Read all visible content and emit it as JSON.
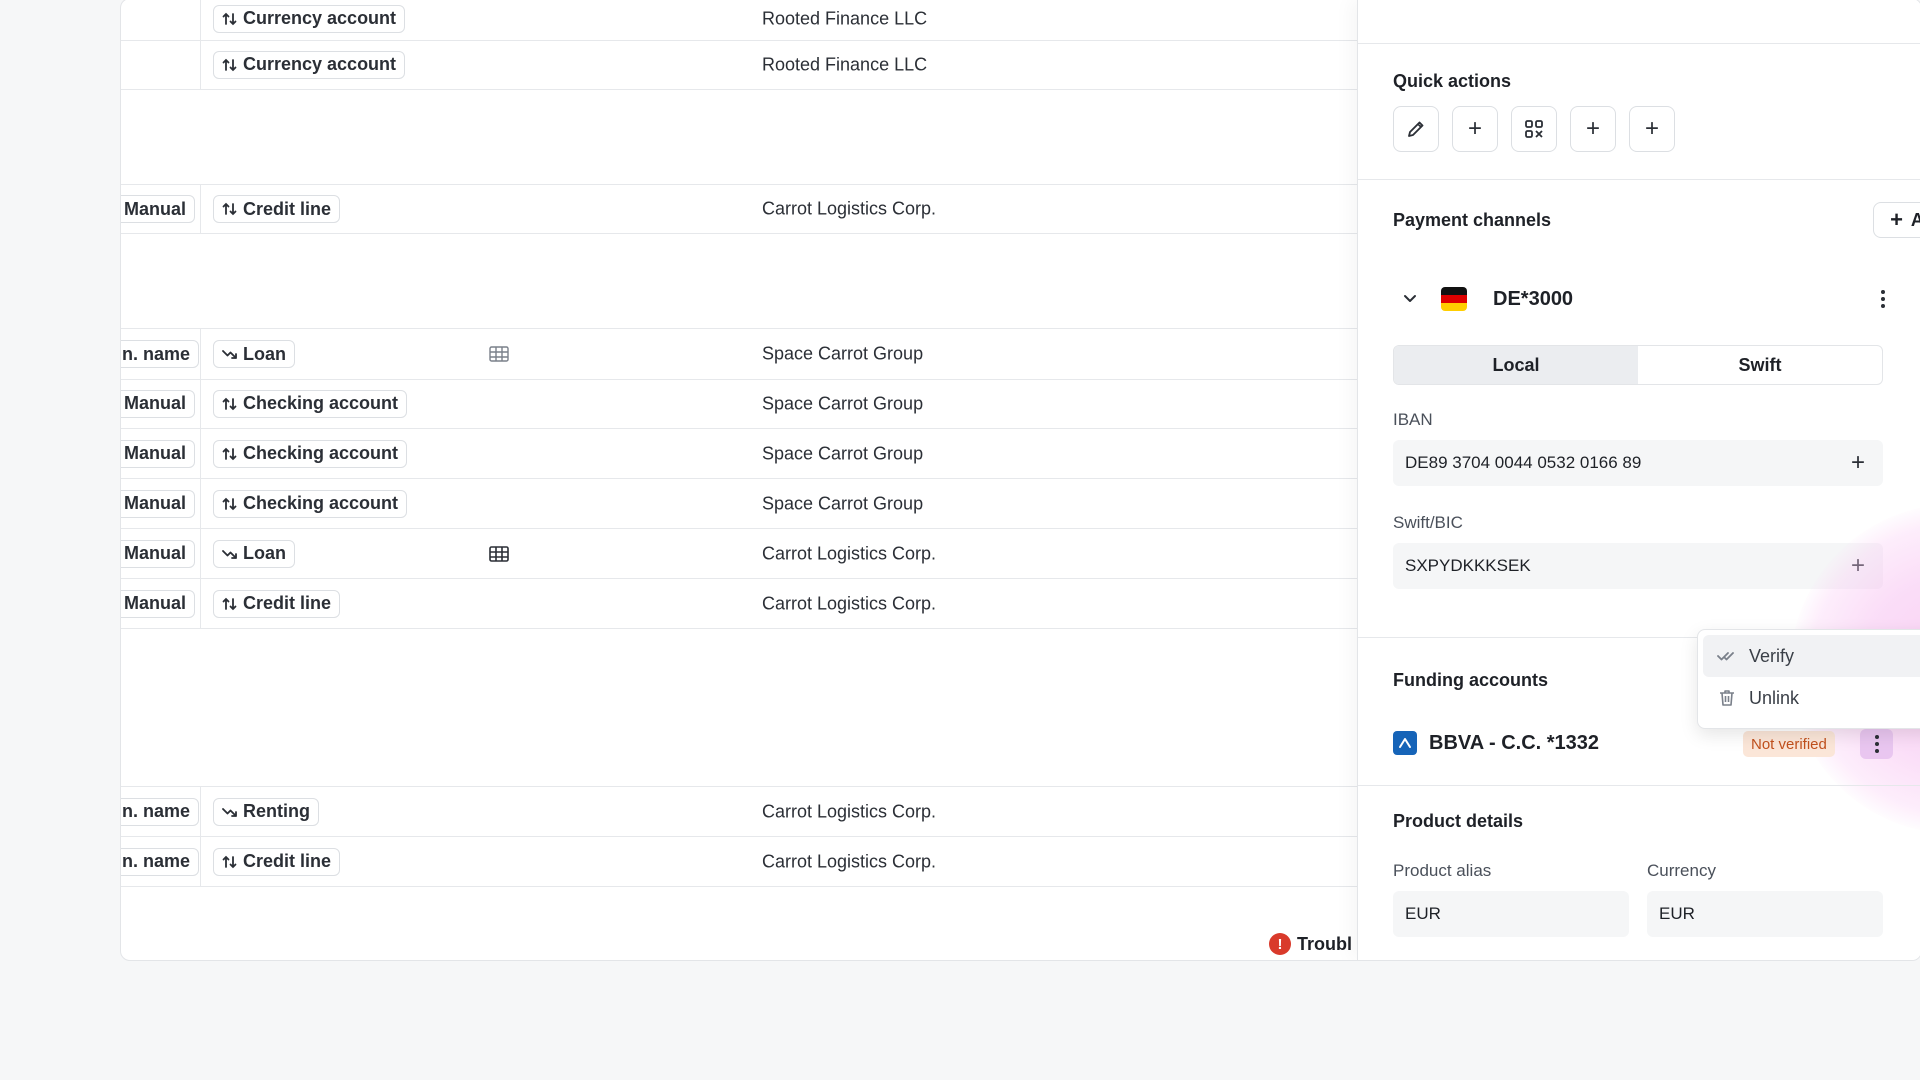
{
  "table": {
    "rows": [
      {
        "source": "",
        "type": "Currency account",
        "company": "Rooted Finance LLC",
        "trend": "up-down",
        "has_grid": false
      },
      {
        "source": "",
        "type": "Currency account",
        "company": "Rooted Finance LLC",
        "trend": "up-down",
        "has_grid": false
      },
      {
        "source": "Manual",
        "type": "Credit line",
        "company": "Carrot Logistics Corp.",
        "trend": "up-down",
        "has_grid": false
      },
      {
        "source": "n. name",
        "type": "Loan",
        "company": "Space Carrot Group",
        "trend": "down",
        "has_grid": true
      },
      {
        "source": "Manual",
        "type": "Checking account",
        "company": "Space Carrot Group",
        "trend": "up-down",
        "has_grid": false
      },
      {
        "source": "Manual",
        "type": "Checking account",
        "company": "Space Carrot Group",
        "trend": "up-down",
        "has_grid": false
      },
      {
        "source": "Manual",
        "type": "Checking account",
        "company": "Space Carrot Group",
        "trend": "up-down",
        "has_grid": false
      },
      {
        "source": "Manual",
        "type": "Loan",
        "company": "Carrot Logistics Corp.",
        "trend": "down",
        "has_grid": true
      },
      {
        "source": "Manual",
        "type": "Credit line",
        "company": "Carrot Logistics Corp.",
        "trend": "up-down",
        "has_grid": false
      },
      {
        "source": "n. name",
        "type": "Renting",
        "company": "Carrot Logistics Corp.",
        "trend": "down",
        "has_grid": false
      },
      {
        "source": "n. name",
        "type": "Credit line",
        "company": "Carrot Logistics Corp.",
        "trend": "up-down",
        "has_grid": false
      }
    ],
    "trouble_text": "Troubl"
  },
  "panel": {
    "quick_actions": {
      "title": "Quick actions",
      "buttons": [
        "pencil-icon",
        "plus-icon",
        "scan-icon",
        "plus-icon",
        "plus-icon"
      ]
    },
    "payment_channels": {
      "title": "Payment channels",
      "add_new_label": "Add new",
      "channel": {
        "name": "DE*3000",
        "flag": "germany",
        "flag_colors": [
          "#111111",
          "#dd0000",
          "#ffce00"
        ]
      },
      "tabs": [
        "Local",
        "Swift"
      ],
      "active_tab": "Local",
      "iban_label": "IBAN",
      "iban_value": "DE89 3704 0044 0532 0166 89",
      "swift_label": "Swift/BIC",
      "swift_value": "SXPYDKKKSEK"
    },
    "context_menu": {
      "items": [
        {
          "label": "Verify",
          "icon": "double-check-icon"
        },
        {
          "label": "Unlink",
          "icon": "trash-icon"
        }
      ]
    },
    "funding_accounts": {
      "title": "Funding accounts",
      "account_name": "BBVA - C.C. *1332",
      "status": "Not verified",
      "status_color": "#c2511d"
    },
    "product_details": {
      "title": "Product details",
      "alias_label": "Product alias",
      "alias_value": "EUR",
      "currency_label": "Currency",
      "currency_value": "EUR"
    }
  }
}
